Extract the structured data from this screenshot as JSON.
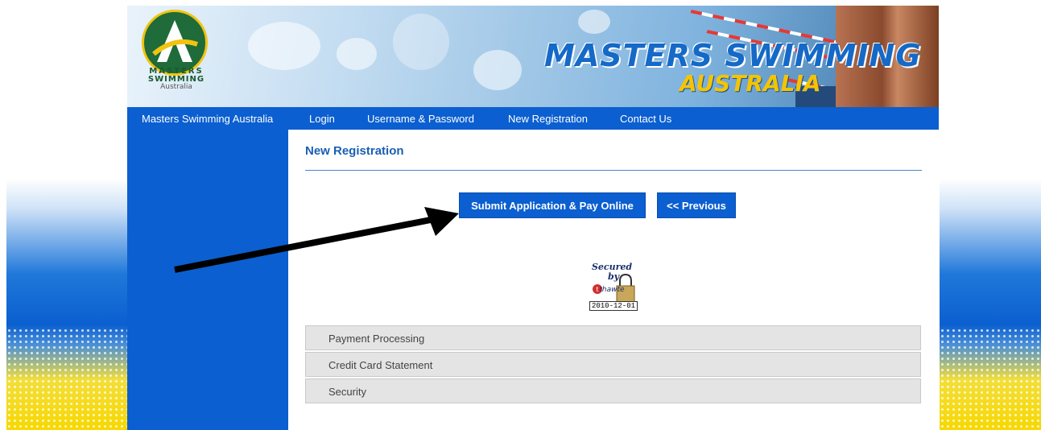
{
  "header": {
    "logo": {
      "line1": "MASTERS",
      "line2": "SWIMMING",
      "line3": "Australia"
    },
    "brand_main": "MASTERS SWIMMING",
    "brand_sub": "AUSTRALIA"
  },
  "nav": {
    "items": [
      {
        "label": "Masters Swimming Australia"
      },
      {
        "label": "Login"
      },
      {
        "label": "Username & Password"
      },
      {
        "label": "New Registration"
      },
      {
        "label": "Contact Us"
      }
    ]
  },
  "main": {
    "title": "New Registration",
    "submit_button": "Submit Application & Pay Online",
    "previous_button": "<< Previous",
    "seal": {
      "line1": "Secured",
      "line2": "by",
      "brand": "thawte",
      "date": "2010-12-01"
    },
    "sections": [
      {
        "label": "Payment Processing"
      },
      {
        "label": "Credit Card Statement"
      },
      {
        "label": "Security"
      }
    ]
  },
  "colors": {
    "nav_blue": "#0b5fd0",
    "title_blue": "#1a5fb4",
    "accordion_bg": "#e4e4e4"
  }
}
